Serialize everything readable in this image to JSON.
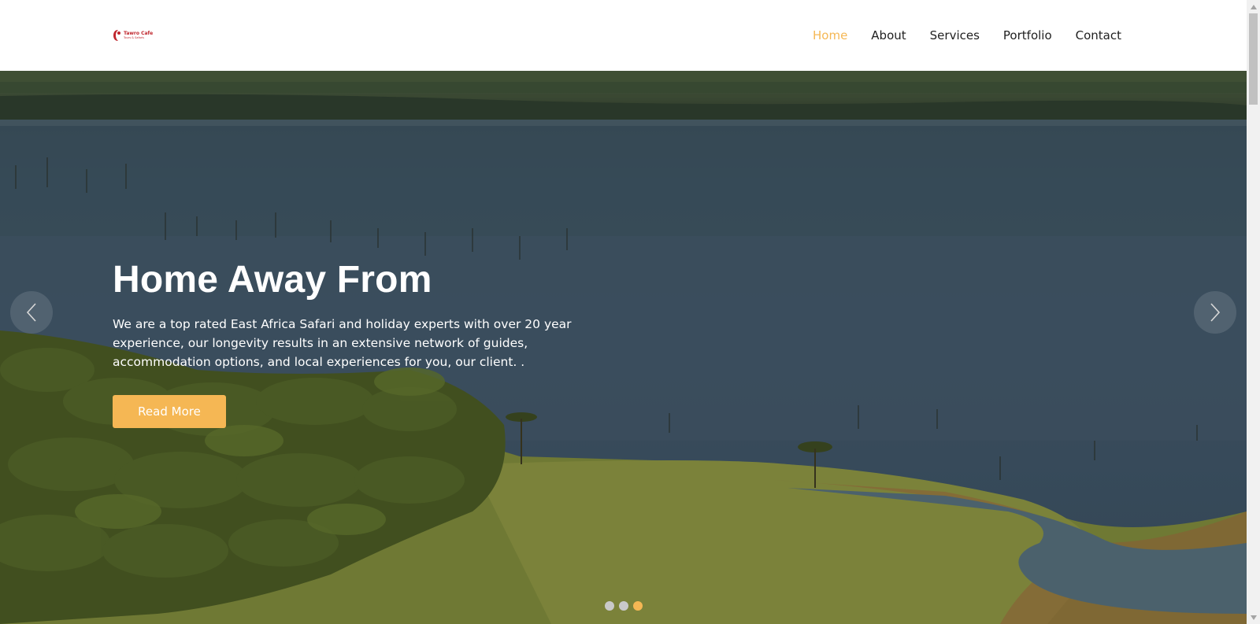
{
  "brand": {
    "logo_line1": "Tawro Cafe",
    "logo_line2": "Tours & Safaris",
    "logo_icon": "logo-icon"
  },
  "nav": {
    "items": [
      {
        "label": "Home",
        "active": true
      },
      {
        "label": "About",
        "active": false
      },
      {
        "label": "Services",
        "active": false
      },
      {
        "label": "Portfolio",
        "active": false
      },
      {
        "label": "Contact",
        "active": false
      }
    ]
  },
  "hero": {
    "title": "Home Away From",
    "description": "We are a top rated East Africa Safari and holiday experts with over 20 year experience, our longevity results in an extensive network of guides, accommodation options, and local experiences for you, our client. .",
    "button_label": "Read More",
    "prev_icon": "chevron-left-icon",
    "next_icon": "chevron-right-icon",
    "slides_total": 3,
    "active_slide": 3
  },
  "colors": {
    "accent": "#f5b754",
    "nav_text": "#1f1f1f",
    "brand_red": "#c0262d"
  }
}
